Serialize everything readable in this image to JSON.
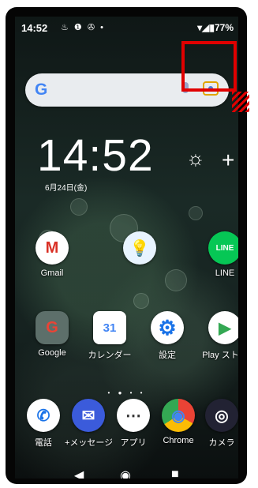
{
  "status_bar": {
    "time": "14:52",
    "notification_icons": "♨ ❶ ✇ •",
    "right_status": "▾◢▮77%"
  },
  "search_bar": {
    "logo": "G",
    "icons": [
      "google-logo",
      "mic-icon",
      "lens-icon"
    ]
  },
  "clock_widget": {
    "time": "14:52",
    "date": "6月24日(金)",
    "weather_icon": "☼",
    "add": "+"
  },
  "apps": {
    "gmail": {
      "label": "Gmail",
      "glyph": "M",
      "color": "#d93025"
    },
    "lightbulb": {
      "label": "",
      "glyph": "💡",
      "color": "#f5d76e"
    },
    "line": {
      "label": "LINE",
      "glyph": "LINE",
      "color": "#06c755"
    },
    "google": {
      "label": "Google",
      "glyph": "G"
    },
    "calendar": {
      "label": "カレンダー",
      "glyph": "31",
      "color": "#4285f4"
    },
    "settings": {
      "label": "設定",
      "glyph": "⚙",
      "color": "#1a73e8"
    },
    "playstore": {
      "label": "Play ストア",
      "glyph": "▶",
      "color": "#34a853"
    },
    "phone": {
      "label": "電話",
      "glyph": "✆"
    },
    "message": {
      "label": "+メッセージ",
      "glyph": "✉"
    },
    "apps": {
      "label": "アプリ",
      "glyph": "⋯"
    },
    "chrome": {
      "label": "Chrome",
      "glyph": "◉"
    },
    "camera": {
      "label": "カメラ",
      "glyph": "◎"
    }
  },
  "page_dots": "• ● • •",
  "navigation": {
    "back": "◀",
    "home": "◉",
    "recent": "■"
  },
  "accent_colors": {
    "annotation": "#e00000"
  }
}
